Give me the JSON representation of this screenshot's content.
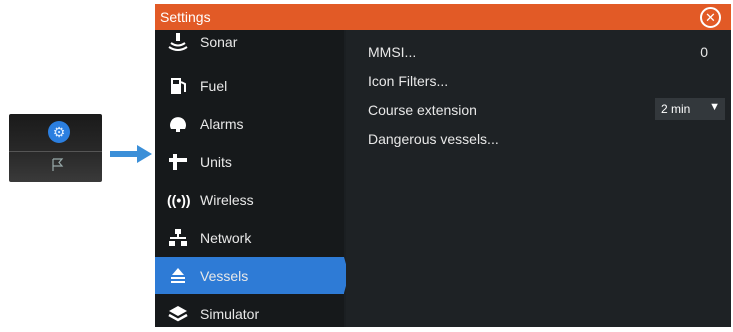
{
  "window": {
    "title": "Settings"
  },
  "sidebar": {
    "items": [
      {
        "label": "Sonar",
        "icon": "sonar-icon"
      },
      {
        "label": "Fuel",
        "icon": "fuel-icon"
      },
      {
        "label": "Alarms",
        "icon": "alarm-icon"
      },
      {
        "label": "Units",
        "icon": "units-icon"
      },
      {
        "label": "Wireless",
        "icon": "wireless-icon"
      },
      {
        "label": "Network",
        "icon": "network-icon"
      },
      {
        "label": "Vessels",
        "icon": "vessels-icon",
        "active": true
      },
      {
        "label": "Simulator",
        "icon": "simulator-icon"
      }
    ]
  },
  "panel": {
    "mmsi_label": "MMSI...",
    "mmsi_value": "0",
    "icon_filters_label": "Icon Filters...",
    "course_extension_label": "Course extension",
    "course_extension_value": "2 min",
    "dangerous_vessels_label": "Dangerous vessels..."
  },
  "colors": {
    "titlebar": "#e25a26",
    "active_item": "#2e7bd6",
    "arrow": "#3b8fd8"
  }
}
